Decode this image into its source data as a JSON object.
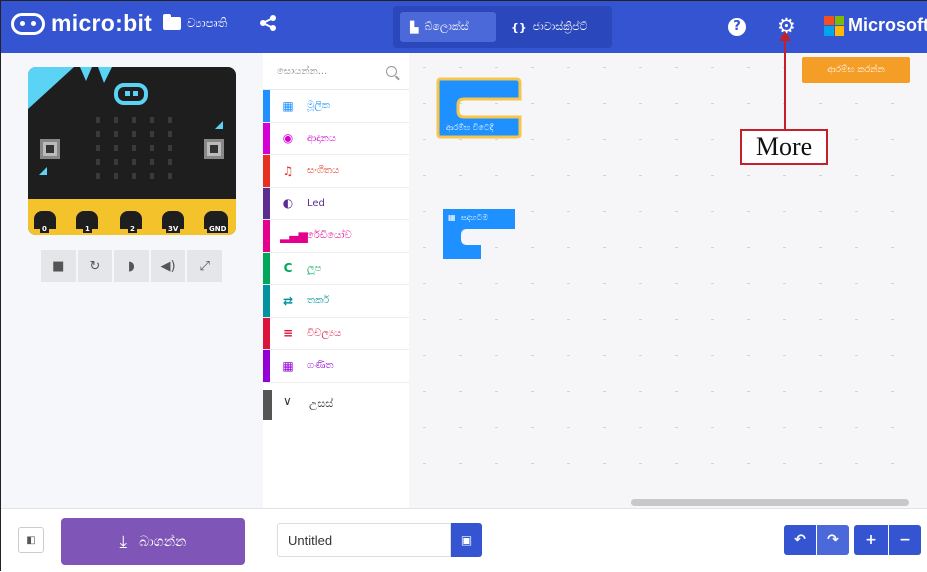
{
  "header": {
    "brand": "micro:bit",
    "projects_label": "ව්‍යාපෘති",
    "share_icon": "share-icon",
    "blocks_label": "බ්ලොක්ස්",
    "javascript_label": "ජාවාස්ක්‍රිප්ට්",
    "javascript_icon_text": "{}",
    "help_icon_text": "?",
    "settings_icon_text": "⚙",
    "microsoft_label": "Microsoft",
    "microsoft_colors": [
      "#f25022",
      "#7fba00",
      "#00a4ef",
      "#ffb900"
    ]
  },
  "simulator": {
    "pins": [
      "0",
      "1",
      "2",
      "3V",
      "GND"
    ],
    "tools": [
      "■",
      "↻",
      "◗",
      "◀)",
      "⤢"
    ]
  },
  "toolbox": {
    "search_placeholder": "සොයන්න...",
    "categories": [
      {
        "label": "මූලික",
        "icon": "▦",
        "color": "#1e90ff"
      },
      {
        "label": "ආදානය",
        "icon": "◉",
        "color": "#d400d4"
      },
      {
        "label": "සංගීතය",
        "icon": "♫",
        "color": "#e63022"
      },
      {
        "label": "Led",
        "icon": "◐",
        "color": "#5c2d91"
      },
      {
        "label": "රේඩියෝව",
        "icon": "▂▄▆",
        "color": "#e3008c"
      },
      {
        "label": "ලූප",
        "icon": "C",
        "color": "#00a65a"
      },
      {
        "label": "තර්ක",
        "icon": "⇄",
        "color": "#00929f"
      },
      {
        "label": "විචල්‍යය",
        "icon": "≡",
        "color": "#dc143c"
      },
      {
        "label": "ගණිත",
        "icon": "▦",
        "color": "#9400d3"
      }
    ],
    "advanced_label": "උසස්"
  },
  "workspace": {
    "start_button": "ආරම්භ කරන්න",
    "on_start_label": "ආරම්භ විටෙදී",
    "forever_label": "සදහටම",
    "annotation": "More"
  },
  "bottom": {
    "download_label": "බාගන්න",
    "project_name": "Untitled",
    "undo_icon": "↶",
    "redo_icon": "↷",
    "zoom_in_icon": "+",
    "zoom_out_icon": "−"
  }
}
